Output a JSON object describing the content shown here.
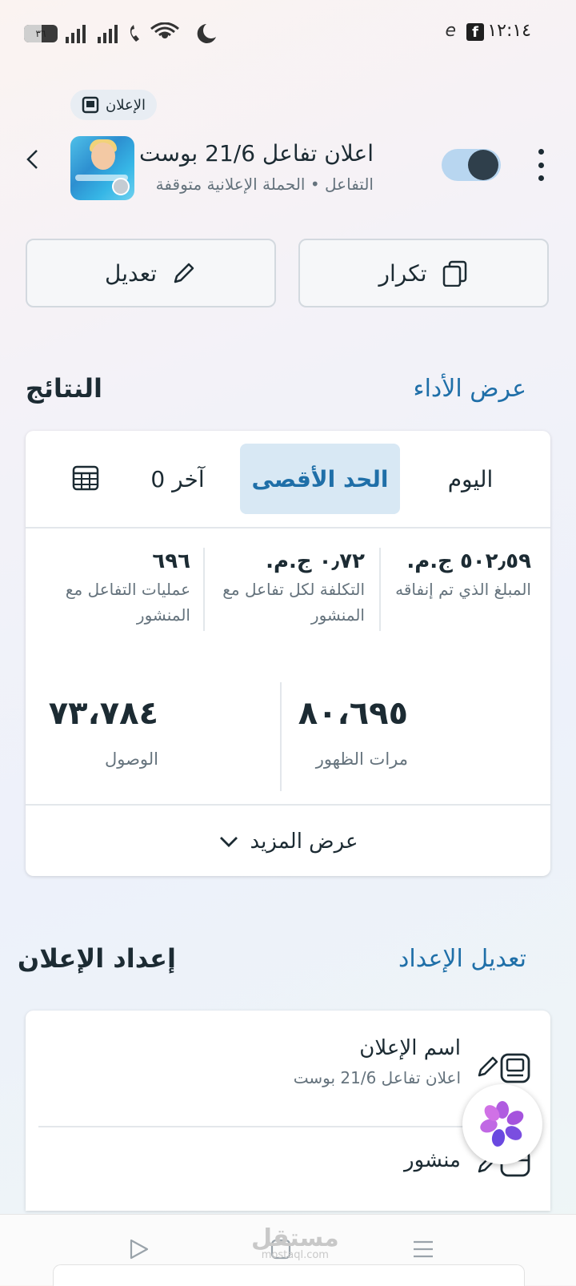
{
  "status_bar": {
    "time": "١٢:١٤",
    "battery": "٣٦"
  },
  "ad_badge": {
    "label": "الإعلان"
  },
  "ad_header": {
    "title": "اعلان تفاعل 21/6 بوست",
    "objective": "التفاعل",
    "separator": "•",
    "status": "الحملة الإعلانية متوقفة",
    "toggle_on": true
  },
  "actions": {
    "duplicate": "تكرار",
    "edit": "تعديل"
  },
  "results": {
    "title": "النتائج",
    "link": "عرض الأداء",
    "tabs": {
      "today": "اليوم",
      "maximum": "الحد الأقصى",
      "last": "آخر 0"
    },
    "metrics": [
      {
        "value": "٥٠٢٫٥٩ ج.م.",
        "label": "المبلغ الذي تم إنفاقه"
      },
      {
        "value": "٠٫٧٢ ج.م.",
        "label": "التكلفة لكل تفاعل مع المنشور"
      },
      {
        "value": "٦٩٦",
        "label": "عمليات  التفاعل مع المنشور"
      }
    ],
    "big_metrics": [
      {
        "value": "٨٠،٦٩٥",
        "label": "مرات الظهور"
      },
      {
        "value": "٧٣،٧٨٤",
        "label": "الوصول"
      }
    ],
    "more": "عرض المزيد"
  },
  "setup": {
    "title": "إعداد الإعلان",
    "link": "تعديل الإعداد",
    "rows": [
      {
        "title": "اسم الإعلان",
        "sub": "اعلان تفاعل 21/6 بوست"
      },
      {
        "title": "منشور",
        "sub": ""
      }
    ]
  },
  "watermark": {
    "text": "مستقل",
    "sub": "mostaql.com"
  }
}
